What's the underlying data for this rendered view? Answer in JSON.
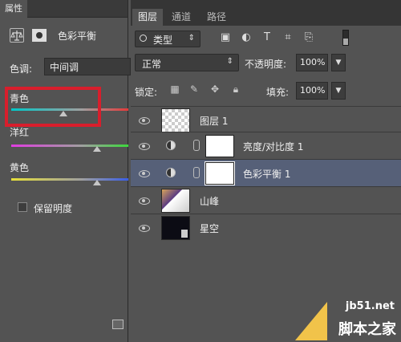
{
  "properties": {
    "tab_label": "属性",
    "title": "色彩平衡",
    "tone_label": "色调:",
    "tone_value": "中间调",
    "sliders": [
      {
        "label": "青色",
        "value": 0
      },
      {
        "label": "洋红",
        "value": 0
      },
      {
        "label": "黄色",
        "value": 0
      }
    ],
    "keep_luminosity_label": "保留明度"
  },
  "layers_panel": {
    "tabs": [
      {
        "label": "图层",
        "active": true
      },
      {
        "label": "通道",
        "active": false
      },
      {
        "label": "路径",
        "active": false
      }
    ],
    "filter_label": "类型",
    "blend_mode": "正常",
    "opacity_label": "不透明度:",
    "opacity_value": "100%",
    "lock_label": "锁定:",
    "fill_label": "填充:",
    "fill_value": "100%",
    "layers": [
      {
        "name": "图层 1",
        "type": "pixel",
        "selected": false
      },
      {
        "name": "亮度/对比度 1",
        "type": "adjustment",
        "selected": false
      },
      {
        "name": "色彩平衡 1",
        "type": "adjustment",
        "selected": true
      },
      {
        "name": "山峰",
        "type": "image",
        "selected": false
      },
      {
        "name": "星空",
        "type": "image",
        "selected": false
      }
    ]
  },
  "watermark": {
    "site": "jb51.net",
    "text": "脚本之家"
  },
  "colors": {
    "panel_bg": "#535353",
    "selected_row": "#566078",
    "highlight_box": "#d81e2c"
  }
}
